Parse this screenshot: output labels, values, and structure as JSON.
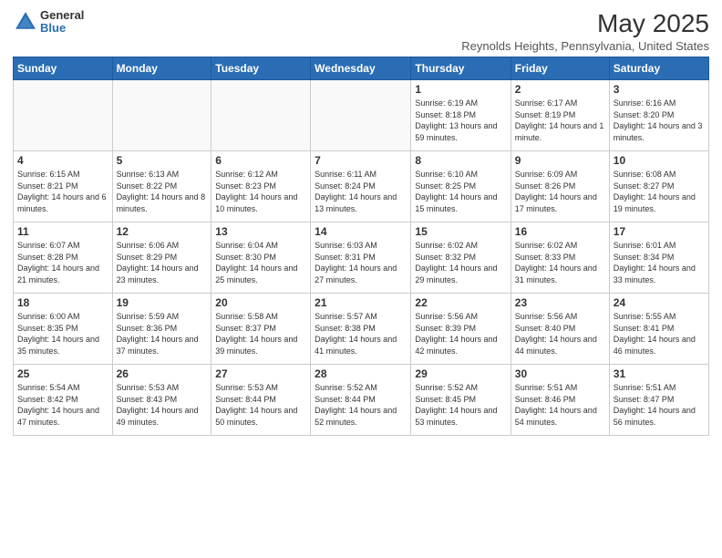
{
  "header": {
    "logo_general": "General",
    "logo_blue": "Blue",
    "main_title": "May 2025",
    "subtitle": "Reynolds Heights, Pennsylvania, United States"
  },
  "days_of_week": [
    "Sunday",
    "Monday",
    "Tuesday",
    "Wednesday",
    "Thursday",
    "Friday",
    "Saturday"
  ],
  "weeks": [
    [
      {
        "day": "",
        "detail": ""
      },
      {
        "day": "",
        "detail": ""
      },
      {
        "day": "",
        "detail": ""
      },
      {
        "day": "",
        "detail": ""
      },
      {
        "day": "1",
        "detail": "Sunrise: 6:19 AM\nSunset: 8:18 PM\nDaylight: 13 hours and 59 minutes."
      },
      {
        "day": "2",
        "detail": "Sunrise: 6:17 AM\nSunset: 8:19 PM\nDaylight: 14 hours and 1 minute."
      },
      {
        "day": "3",
        "detail": "Sunrise: 6:16 AM\nSunset: 8:20 PM\nDaylight: 14 hours and 3 minutes."
      }
    ],
    [
      {
        "day": "4",
        "detail": "Sunrise: 6:15 AM\nSunset: 8:21 PM\nDaylight: 14 hours and 6 minutes."
      },
      {
        "day": "5",
        "detail": "Sunrise: 6:13 AM\nSunset: 8:22 PM\nDaylight: 14 hours and 8 minutes."
      },
      {
        "day": "6",
        "detail": "Sunrise: 6:12 AM\nSunset: 8:23 PM\nDaylight: 14 hours and 10 minutes."
      },
      {
        "day": "7",
        "detail": "Sunrise: 6:11 AM\nSunset: 8:24 PM\nDaylight: 14 hours and 13 minutes."
      },
      {
        "day": "8",
        "detail": "Sunrise: 6:10 AM\nSunset: 8:25 PM\nDaylight: 14 hours and 15 minutes."
      },
      {
        "day": "9",
        "detail": "Sunrise: 6:09 AM\nSunset: 8:26 PM\nDaylight: 14 hours and 17 minutes."
      },
      {
        "day": "10",
        "detail": "Sunrise: 6:08 AM\nSunset: 8:27 PM\nDaylight: 14 hours and 19 minutes."
      }
    ],
    [
      {
        "day": "11",
        "detail": "Sunrise: 6:07 AM\nSunset: 8:28 PM\nDaylight: 14 hours and 21 minutes."
      },
      {
        "day": "12",
        "detail": "Sunrise: 6:06 AM\nSunset: 8:29 PM\nDaylight: 14 hours and 23 minutes."
      },
      {
        "day": "13",
        "detail": "Sunrise: 6:04 AM\nSunset: 8:30 PM\nDaylight: 14 hours and 25 minutes."
      },
      {
        "day": "14",
        "detail": "Sunrise: 6:03 AM\nSunset: 8:31 PM\nDaylight: 14 hours and 27 minutes."
      },
      {
        "day": "15",
        "detail": "Sunrise: 6:02 AM\nSunset: 8:32 PM\nDaylight: 14 hours and 29 minutes."
      },
      {
        "day": "16",
        "detail": "Sunrise: 6:02 AM\nSunset: 8:33 PM\nDaylight: 14 hours and 31 minutes."
      },
      {
        "day": "17",
        "detail": "Sunrise: 6:01 AM\nSunset: 8:34 PM\nDaylight: 14 hours and 33 minutes."
      }
    ],
    [
      {
        "day": "18",
        "detail": "Sunrise: 6:00 AM\nSunset: 8:35 PM\nDaylight: 14 hours and 35 minutes."
      },
      {
        "day": "19",
        "detail": "Sunrise: 5:59 AM\nSunset: 8:36 PM\nDaylight: 14 hours and 37 minutes."
      },
      {
        "day": "20",
        "detail": "Sunrise: 5:58 AM\nSunset: 8:37 PM\nDaylight: 14 hours and 39 minutes."
      },
      {
        "day": "21",
        "detail": "Sunrise: 5:57 AM\nSunset: 8:38 PM\nDaylight: 14 hours and 41 minutes."
      },
      {
        "day": "22",
        "detail": "Sunrise: 5:56 AM\nSunset: 8:39 PM\nDaylight: 14 hours and 42 minutes."
      },
      {
        "day": "23",
        "detail": "Sunrise: 5:56 AM\nSunset: 8:40 PM\nDaylight: 14 hours and 44 minutes."
      },
      {
        "day": "24",
        "detail": "Sunrise: 5:55 AM\nSunset: 8:41 PM\nDaylight: 14 hours and 46 minutes."
      }
    ],
    [
      {
        "day": "25",
        "detail": "Sunrise: 5:54 AM\nSunset: 8:42 PM\nDaylight: 14 hours and 47 minutes."
      },
      {
        "day": "26",
        "detail": "Sunrise: 5:53 AM\nSunset: 8:43 PM\nDaylight: 14 hours and 49 minutes."
      },
      {
        "day": "27",
        "detail": "Sunrise: 5:53 AM\nSunset: 8:44 PM\nDaylight: 14 hours and 50 minutes."
      },
      {
        "day": "28",
        "detail": "Sunrise: 5:52 AM\nSunset: 8:44 PM\nDaylight: 14 hours and 52 minutes."
      },
      {
        "day": "29",
        "detail": "Sunrise: 5:52 AM\nSunset: 8:45 PM\nDaylight: 14 hours and 53 minutes."
      },
      {
        "day": "30",
        "detail": "Sunrise: 5:51 AM\nSunset: 8:46 PM\nDaylight: 14 hours and 54 minutes."
      },
      {
        "day": "31",
        "detail": "Sunrise: 5:51 AM\nSunset: 8:47 PM\nDaylight: 14 hours and 56 minutes."
      }
    ]
  ]
}
